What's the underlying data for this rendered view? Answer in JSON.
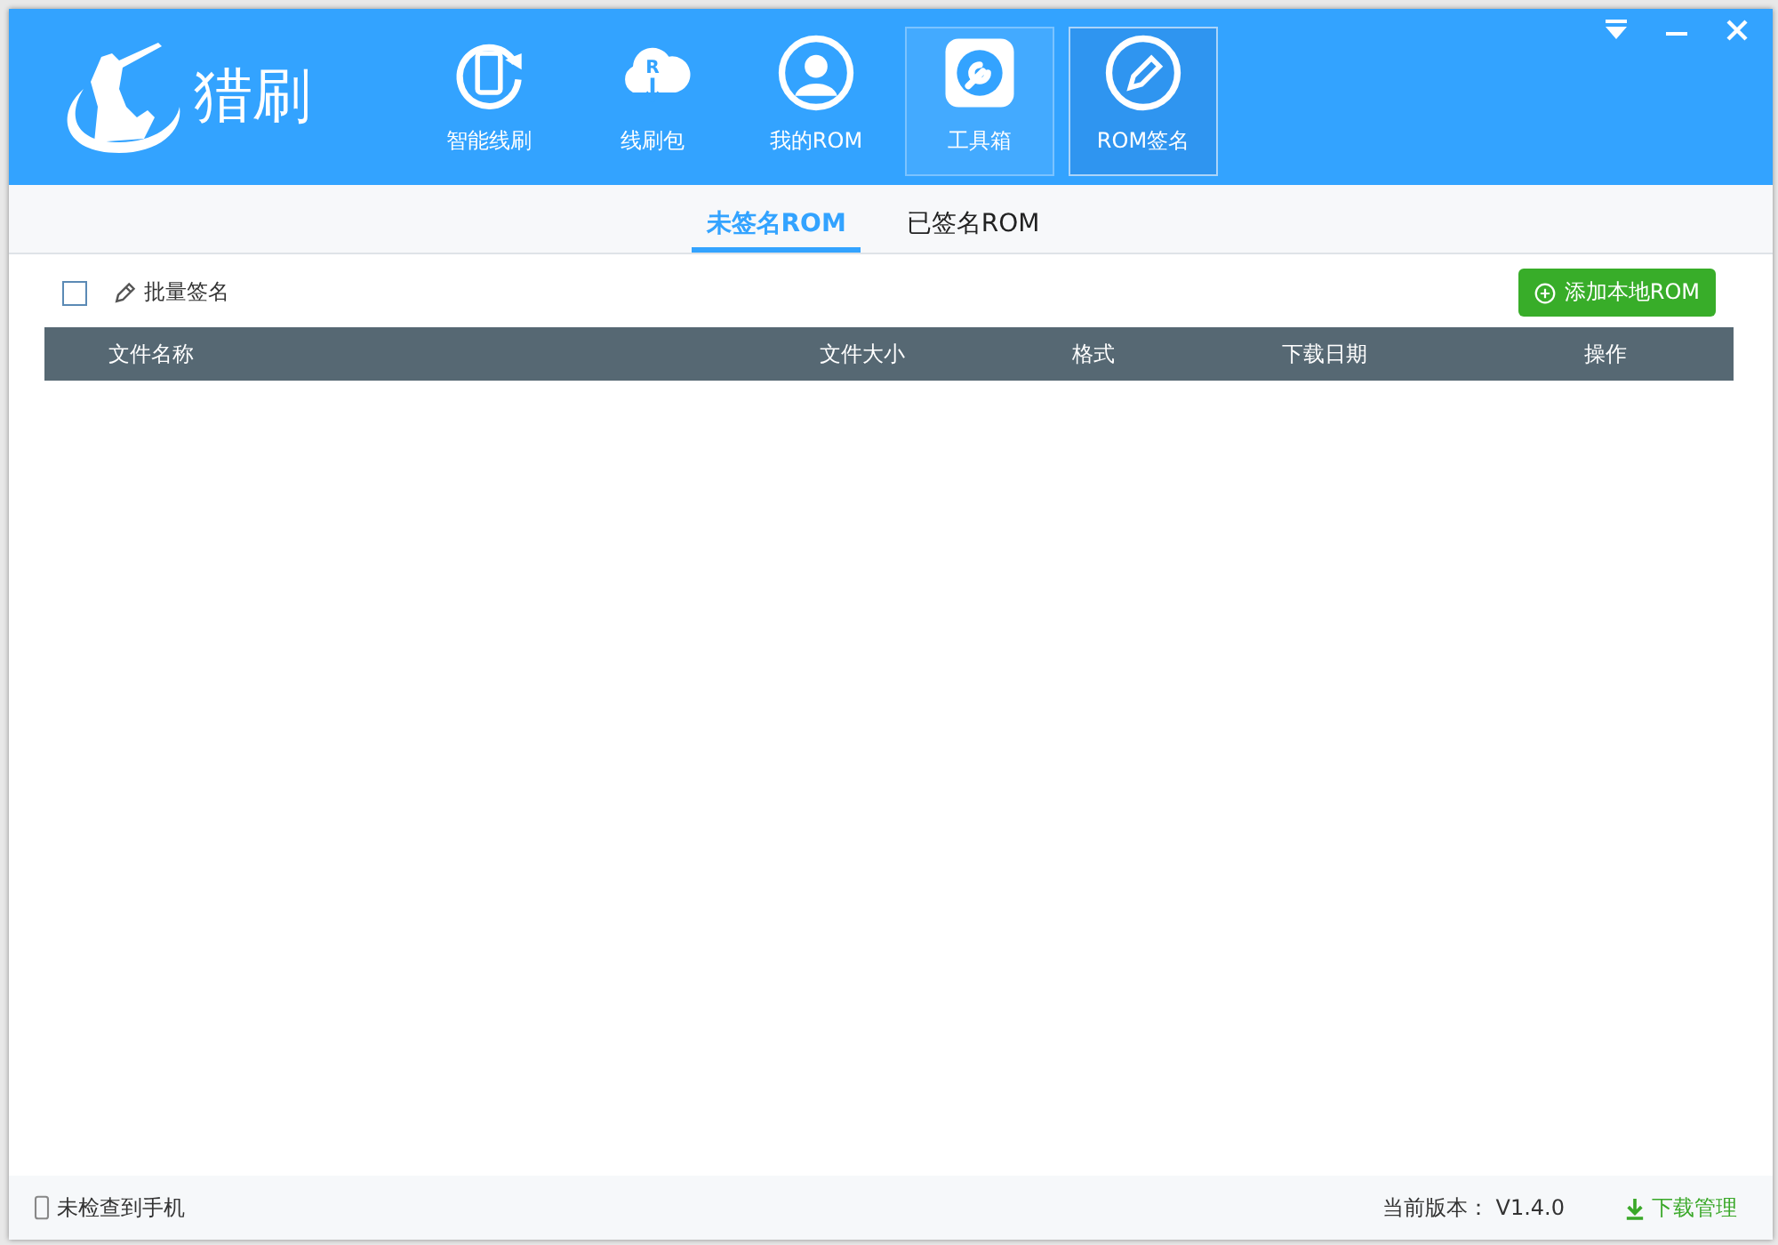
{
  "app": {
    "name": "猎刷"
  },
  "nav": [
    {
      "label": "智能线刷",
      "kind": "phone",
      "selected": false,
      "hovered": false
    },
    {
      "label": "线刷包",
      "kind": "cloud",
      "icon_letter": "R",
      "selected": false,
      "hovered": false
    },
    {
      "label": "我的ROM",
      "kind": "user",
      "selected": false,
      "hovered": false
    },
    {
      "label": "工具箱",
      "kind": "wrench",
      "selected": false,
      "hovered": true
    },
    {
      "label": "ROM签名",
      "kind": "pen",
      "selected": true,
      "hovered": false
    }
  ],
  "tabs": [
    {
      "label": "未签名ROM",
      "selected": true
    },
    {
      "label": "已签名ROM",
      "selected": false
    }
  ],
  "toolbar": {
    "select_all": {
      "checked": false
    },
    "batch_sign": "批量签名",
    "add_button": "添加本地ROM"
  },
  "table": {
    "columns": [
      "文件名称",
      "文件大小",
      "格式",
      "下载日期",
      "操作"
    ]
  },
  "status_bar": {
    "device": "未检查到手机",
    "version_label": "当前版本：",
    "version": "V1.4.0",
    "download_manager": "下载管理"
  }
}
